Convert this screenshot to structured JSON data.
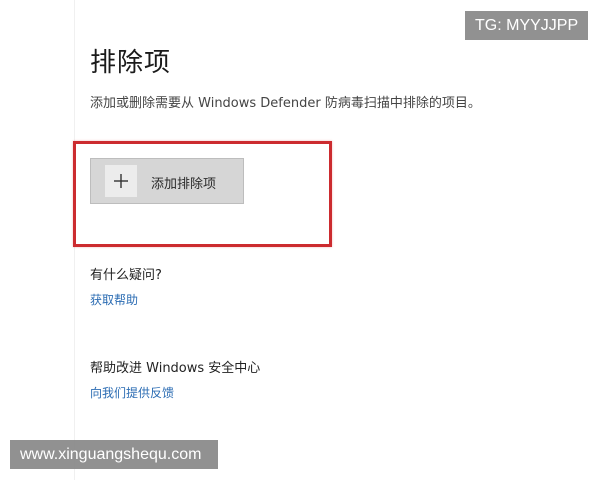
{
  "page": {
    "title": "排除项",
    "description": "添加或删除需要从 Windows Defender 防病毒扫描中排除的项目。"
  },
  "add_exclusion": {
    "icon": "plus-icon",
    "label": "添加排除项"
  },
  "help": {
    "heading": "有什么疑问?",
    "link": "获取帮助"
  },
  "feedback": {
    "heading": "帮助改进 Windows 安全中心",
    "link": "向我们提供反馈"
  },
  "watermarks": {
    "top_right": "TG: MYYJJPP",
    "bottom_left": "www.xinguangshequ.com"
  },
  "colors": {
    "highlight_border": "#cc2b2f",
    "link": "#2b6cb3",
    "button_bg": "#d6d6d6"
  }
}
